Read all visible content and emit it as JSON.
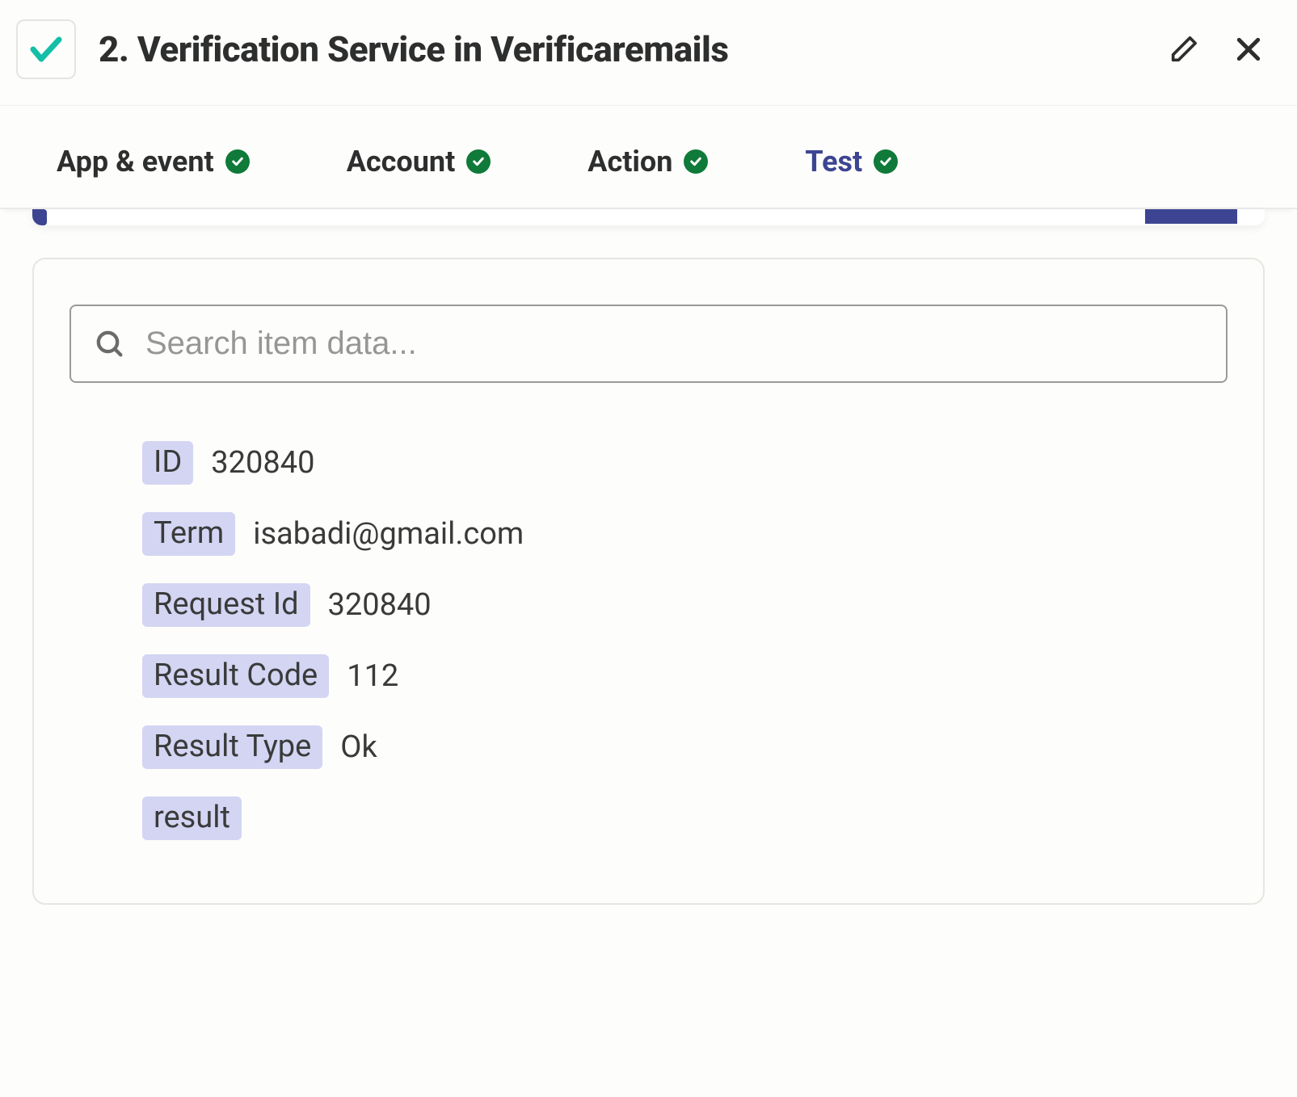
{
  "header": {
    "title": "2. Verification Service in Verificaremails"
  },
  "tabs": [
    {
      "label": "App & event",
      "active": false,
      "complete": true
    },
    {
      "label": "Account",
      "active": false,
      "complete": true
    },
    {
      "label": "Action",
      "active": false,
      "complete": true
    },
    {
      "label": "Test",
      "active": true,
      "complete": true
    }
  ],
  "search": {
    "placeholder": "Search item data..."
  },
  "fields": [
    {
      "key": "ID",
      "value": "320840"
    },
    {
      "key": "Term",
      "value": "isabadi@gmail.com"
    },
    {
      "key": "Request Id",
      "value": "320840"
    },
    {
      "key": "Result Code",
      "value": "112"
    },
    {
      "key": "Result Type",
      "value": "Ok"
    },
    {
      "key": "result",
      "value": ""
    }
  ]
}
